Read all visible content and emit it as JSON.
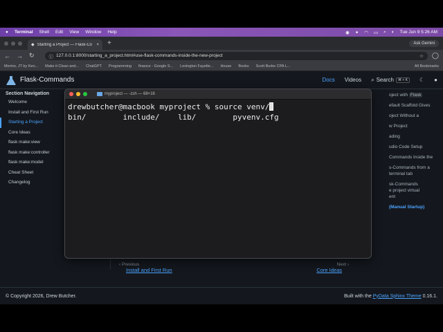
{
  "menubar": {
    "apple": "",
    "items": [
      "Terminal",
      "Shell",
      "Edit",
      "View",
      "Window",
      "Help"
    ],
    "clock": "Tue Jun 9  5:26 AM"
  },
  "browser": {
    "tab_title": "Starting a Project — Flask-Co",
    "new_tab": "+",
    "ask_gemini": "Ask Gemini",
    "url": "127.0.0.1:8000/starting_a_project.html#use-flask-commands-inside-the-new-project",
    "bookmarks": [
      "Merino, JT by Ken...",
      "Make it Clean and...",
      "ChatGPT",
      "Programming",
      "finance - Google S...",
      "Lexington Fayette...",
      "House",
      "Books",
      "Scott Burke CPA L..."
    ],
    "all_bookmarks": "All Bookmarks"
  },
  "docs": {
    "site_title": "Flask-Commands",
    "nav_docs": "Docs",
    "nav_videos": "Videos",
    "search_label": "Search",
    "search_kbd": "⌘ + K",
    "sidebar_heading": "Section Navigation",
    "sidebar": [
      {
        "label": "Welcome"
      },
      {
        "label": "Install and First Run"
      },
      {
        "label": "Starting a Project"
      },
      {
        "label": "Core Ideas"
      },
      {
        "label": "flask make:view"
      },
      {
        "label": "flask make:controller"
      },
      {
        "label": "flask make:model"
      },
      {
        "label": "Cheat Sheet"
      },
      {
        "label": "Changelog"
      }
    ],
    "toc": [
      {
        "pre": "oject with",
        "code": "Flask"
      },
      {
        "text": "efault Scaffold Gives"
      },
      {
        "text": "oject Without a\n"
      },
      {
        "text": "w Project"
      },
      {
        "text": "ading"
      },
      {
        "text": "udio Code Setup"
      },
      {
        "text": "Commands Inside the"
      },
      {
        "text": "s-Commands from a\nterminal tab"
      },
      {
        "text": "sk-Commands\ne project virtual\nent"
      },
      {
        "text": "(Manual Startup)"
      }
    ],
    "prev_label": "Previous",
    "prev_link": "Install and First Run",
    "next_label": "Next",
    "next_link": "Core Ideas",
    "footer_copyright": "© Copyright 2026, Drew Butcher.",
    "footer_built_prefix": "Built with the",
    "footer_theme": "PyData Sphinx Theme",
    "footer_version": "0.16.1."
  },
  "terminal": {
    "title": "myproject — -zsh — 68×16",
    "prompt": "drewbutcher@macbook myproject % source venv/",
    "ls_output": "bin/        include/    lib/        pyvenv.cfg"
  },
  "colors": {
    "accent": "#4da3ff",
    "close": "#ff5f57",
    "minimize": "#febc2e",
    "zoom": "#28c840"
  }
}
